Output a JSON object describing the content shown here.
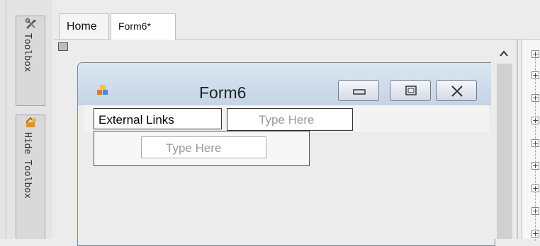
{
  "left_tabs": [
    {
      "label": "Toolbox",
      "icon": "toolbox-icon"
    },
    {
      "label": "Hide Toolbox",
      "icon": "hide-toolbox-icon"
    }
  ],
  "doc_tabs": [
    {
      "label": "Home",
      "active": false
    },
    {
      "label": "Form6*",
      "active": true
    }
  ],
  "form": {
    "title": "Form6",
    "menu_item": "External Links",
    "type_here_top": "Type Here",
    "type_here_sub": "Type Here"
  },
  "window_buttons": [
    "minimize",
    "restore",
    "close"
  ],
  "tree_panel": {
    "node_count": 9,
    "node_symbol": "+"
  },
  "colors": {
    "title_bar": "#c4d4e6",
    "placeholder_text": "#9a9a9a"
  }
}
